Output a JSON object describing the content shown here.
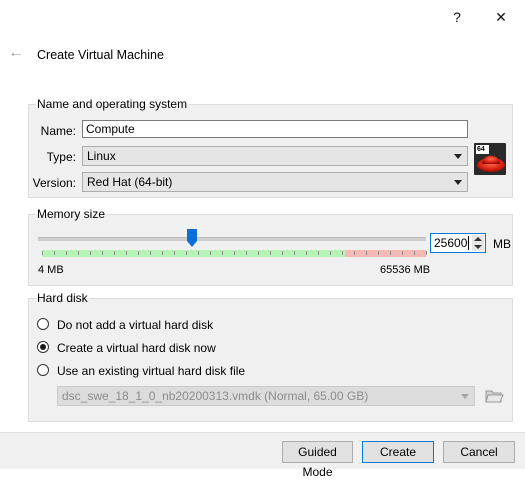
{
  "window": {
    "help_glyph": "?",
    "close_glyph": "✕",
    "back_glyph": "←",
    "title": "Create Virtual Machine"
  },
  "name_os": {
    "group_title": "Name and operating system",
    "name_label": "Name:",
    "name_value": "Compute",
    "type_label": "Type:",
    "type_value": "Linux",
    "version_label": "Version:",
    "version_value": "Red Hat (64-bit)",
    "os_icon": "redhat-64bit-icon",
    "os_badge": "64"
  },
  "memory": {
    "group_title": "Memory size",
    "value": "25600",
    "unit": "MB",
    "min_label": "4 MB",
    "max_label": "65536 MB",
    "min_mb": 4,
    "max_mb": 65536,
    "current_mb": 25600,
    "safe_fraction": 0.75,
    "colors": {
      "safe": "#b6f3b6",
      "danger": "#f6b9b4",
      "thumb": "#0a6fd6"
    }
  },
  "hard_disk": {
    "group_title": "Hard disk",
    "options": [
      {
        "label": "Do not add a virtual hard disk",
        "selected": false
      },
      {
        "label": "Create a virtual hard disk now",
        "selected": true
      },
      {
        "label": "Use an existing virtual hard disk file",
        "selected": false
      }
    ],
    "existing_file": "dsc_swe_18_1_0_nb20200313.vmdk (Normal, 65.00 GB)",
    "folder_icon": "folder-open-icon"
  },
  "buttons": {
    "guided": "Guided Mode",
    "create": "Create",
    "cancel": "Cancel"
  }
}
